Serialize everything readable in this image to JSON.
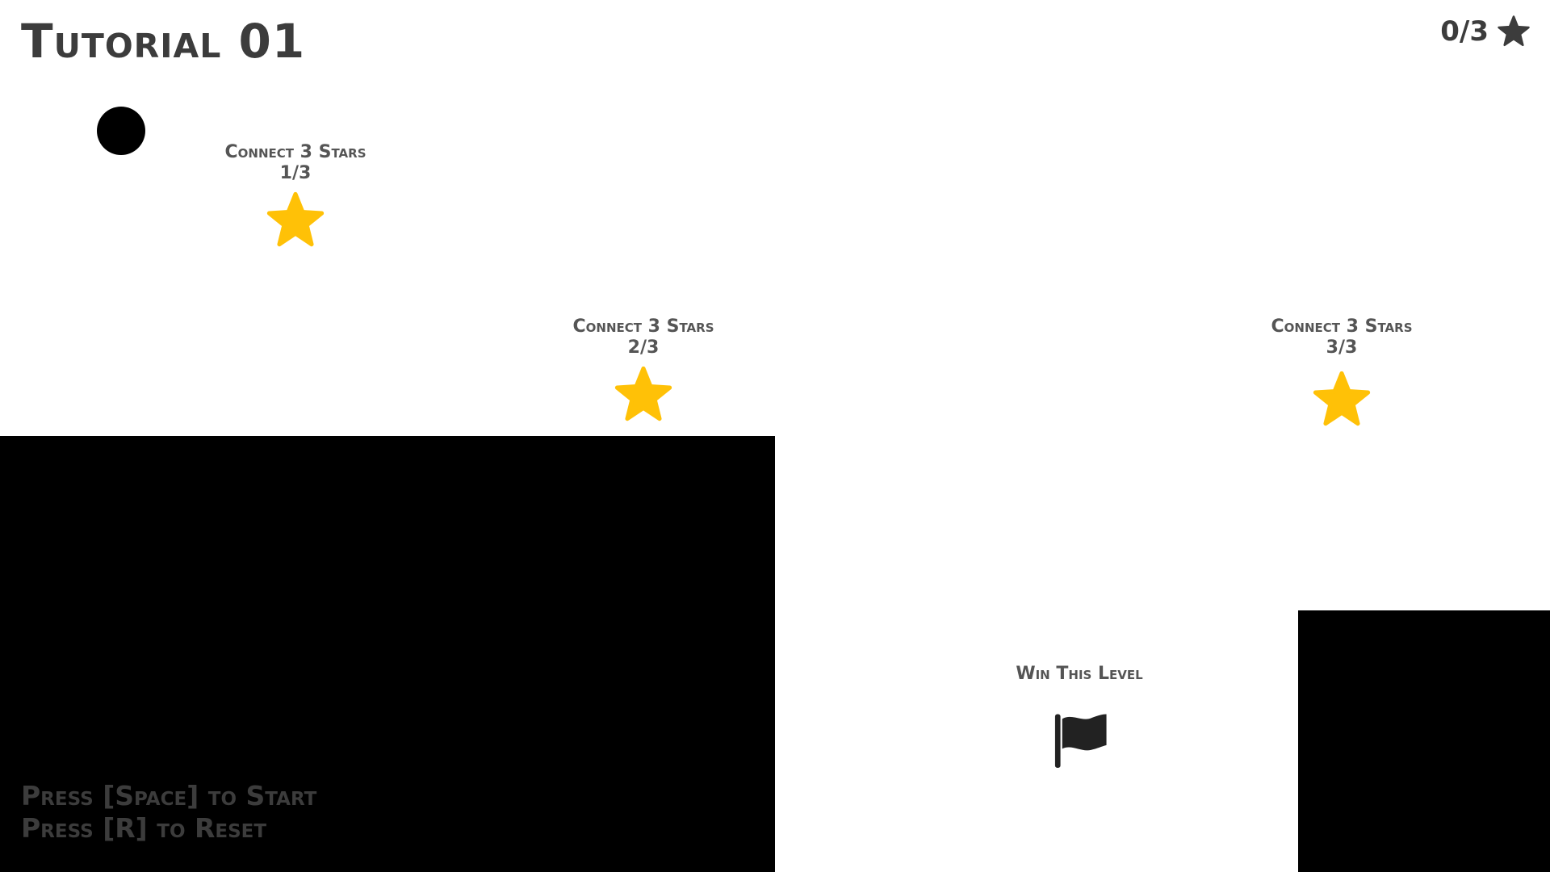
{
  "level": {
    "title": "Tutorial 01"
  },
  "star_counter": {
    "text": "0/3",
    "icon": "star-icon",
    "color": "#3c3c3c"
  },
  "player": {
    "icon": "ball",
    "color": "#000000"
  },
  "objectives": [
    {
      "label": "Connect 3 Stars",
      "progress": "1/3",
      "icon": "star-icon",
      "color": "#ffc107"
    },
    {
      "label": "Connect 3 Stars",
      "progress": "2/3",
      "icon": "star-icon",
      "color": "#ffc107"
    },
    {
      "label": "Connect 3 Stars",
      "progress": "3/3",
      "icon": "star-icon",
      "color": "#ffc107"
    }
  ],
  "goal": {
    "label": "Win This Level",
    "icon": "flag-icon",
    "color": "#222222"
  },
  "instructions": {
    "start": "Press [Space] to Start",
    "reset": "Press [R] to Reset"
  },
  "colors": {
    "background": "#ffffff",
    "platform": "#000000",
    "text": "#3c3c3c",
    "label": "#555555"
  }
}
